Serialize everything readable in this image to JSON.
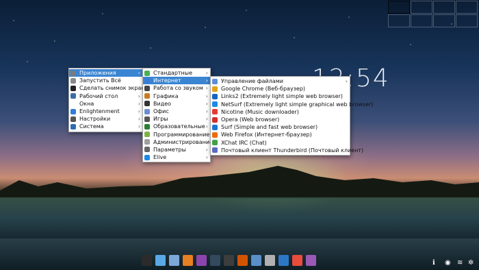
{
  "clock": {
    "time": "12:54"
  },
  "main_menu": {
    "items": [
      {
        "label": "Приложения",
        "icon": "gear-icon",
        "submenu": true,
        "active": true,
        "color": "#7b7b7b"
      },
      {
        "label": "Запустить Всё",
        "icon": "run-icon",
        "submenu": false,
        "color": "#8a8a8a"
      },
      {
        "label": "Сделать снимок экрана",
        "icon": "camera-icon",
        "submenu": false,
        "color": "#222222"
      },
      {
        "label": "Рабочий стол",
        "icon": "desktop-icon",
        "submenu": true,
        "color": "#3b6ea5"
      },
      {
        "label": "Окна",
        "icon": "window-icon",
        "submenu": true,
        "color": "#ffffff"
      },
      {
        "label": "Enlightenment",
        "icon": "enlightenment-icon",
        "submenu": true,
        "color": "#2f7fd6"
      },
      {
        "label": "Настройки",
        "icon": "settings-icon",
        "submenu": true,
        "color": "#555555"
      },
      {
        "label": "Система",
        "icon": "system-icon",
        "submenu": true,
        "color": "#2a6fb5"
      }
    ]
  },
  "apps_menu": {
    "items": [
      {
        "label": "Стандартные",
        "icon": "accessories-icon",
        "submenu": true,
        "color": "#4caf50"
      },
      {
        "label": "Интернет",
        "icon": "globe-icon",
        "submenu": true,
        "active": true,
        "color": "#3a7bd5"
      },
      {
        "label": "Работа со звуком",
        "icon": "audio-icon",
        "submenu": true,
        "color": "#444444"
      },
      {
        "label": "Графика",
        "icon": "graphics-icon",
        "submenu": true,
        "color": "#c97a20"
      },
      {
        "label": "Видео",
        "icon": "video-icon",
        "submenu": true,
        "color": "#333333"
      },
      {
        "label": "Офис",
        "icon": "office-icon",
        "submenu": true,
        "color": "#6a8fd0"
      },
      {
        "label": "Игры",
        "icon": "games-icon",
        "submenu": true,
        "color": "#555555"
      },
      {
        "label": "Образовательные",
        "icon": "education-icon",
        "submenu": true,
        "color": "#2e7d32"
      },
      {
        "label": "Программирование",
        "icon": "development-icon",
        "submenu": true,
        "color": "#7cb342"
      },
      {
        "label": "Администрирование",
        "icon": "admin-icon",
        "submenu": true,
        "color": "#9e9e9e"
      },
      {
        "label": "Параметры",
        "icon": "preferences-icon",
        "submenu": true,
        "color": "#666666"
      },
      {
        "label": "Elive",
        "icon": "elive-icon",
        "submenu": true,
        "color": "#1e88e5"
      }
    ]
  },
  "internet_menu": {
    "items": [
      {
        "label": "Управление файлами",
        "icon": "file-manager-icon",
        "submenu": true,
        "color": "#5d8fd6"
      },
      {
        "label": "Google Chrome (Веб-браузер)",
        "icon": "chrome-icon",
        "color": "#e3a21a"
      },
      {
        "label": "Links2 (Extremely light simple web browser)",
        "icon": "links2-icon",
        "color": "#1565c0"
      },
      {
        "label": "NetSurf (Extremely light simple graphical web browser)",
        "icon": "netsurf-icon",
        "color": "#1e88e5"
      },
      {
        "label": "Nicotine (Music downloader)",
        "icon": "nicotine-icon",
        "color": "#e53935"
      },
      {
        "label": "Opera (Web browser)",
        "icon": "opera-icon",
        "color": "#d32f2f"
      },
      {
        "label": "Surf (Simple and fast web browser)",
        "icon": "surf-icon",
        "color": "#1976d2"
      },
      {
        "label": "Web Firefox (Интернет-браузер)",
        "icon": "firefox-icon",
        "color": "#ef6c00"
      },
      {
        "label": "XChat IRC (Chat)",
        "icon": "xchat-icon",
        "color": "#43a047"
      },
      {
        "label": "Почтовый клиент Thunderbird (Почтовый клиент)",
        "icon": "thunderbird-icon",
        "color": "#5c6bc0"
      }
    ]
  },
  "dock": {
    "items": [
      {
        "icon": "terminal-icon",
        "color": "#2b2b2b"
      },
      {
        "icon": "chat-icon",
        "color": "#5aa9e6"
      },
      {
        "icon": "text-editor-icon",
        "color": "#7da7d9"
      },
      {
        "icon": "firefox-icon",
        "color": "#e67e22"
      },
      {
        "icon": "audio-player-icon",
        "color": "#8e44ad"
      },
      {
        "icon": "screen-recorder-icon",
        "color": "#34495e"
      },
      {
        "icon": "image-viewer-icon",
        "color": "#3d3d3d"
      },
      {
        "icon": "video-editor-icon",
        "color": "#d35400"
      },
      {
        "icon": "virtualbox-icon",
        "color": "#5a8fc8"
      },
      {
        "icon": "package-icon",
        "color": "#b0b0b0"
      },
      {
        "icon": "search-icon",
        "color": "#2c78c6"
      },
      {
        "icon": "help-icon",
        "color": "#e74c3c"
      },
      {
        "icon": "apps-icon",
        "color": "#9b59b6"
      }
    ]
  },
  "tray": {
    "items": [
      {
        "icon": "info-icon",
        "glyph": "ℹ"
      },
      {
        "icon": "volume-icon",
        "glyph": "◉"
      },
      {
        "icon": "wifi-icon",
        "glyph": "≋"
      },
      {
        "icon": "settings-icon",
        "glyph": "✲"
      }
    ]
  }
}
